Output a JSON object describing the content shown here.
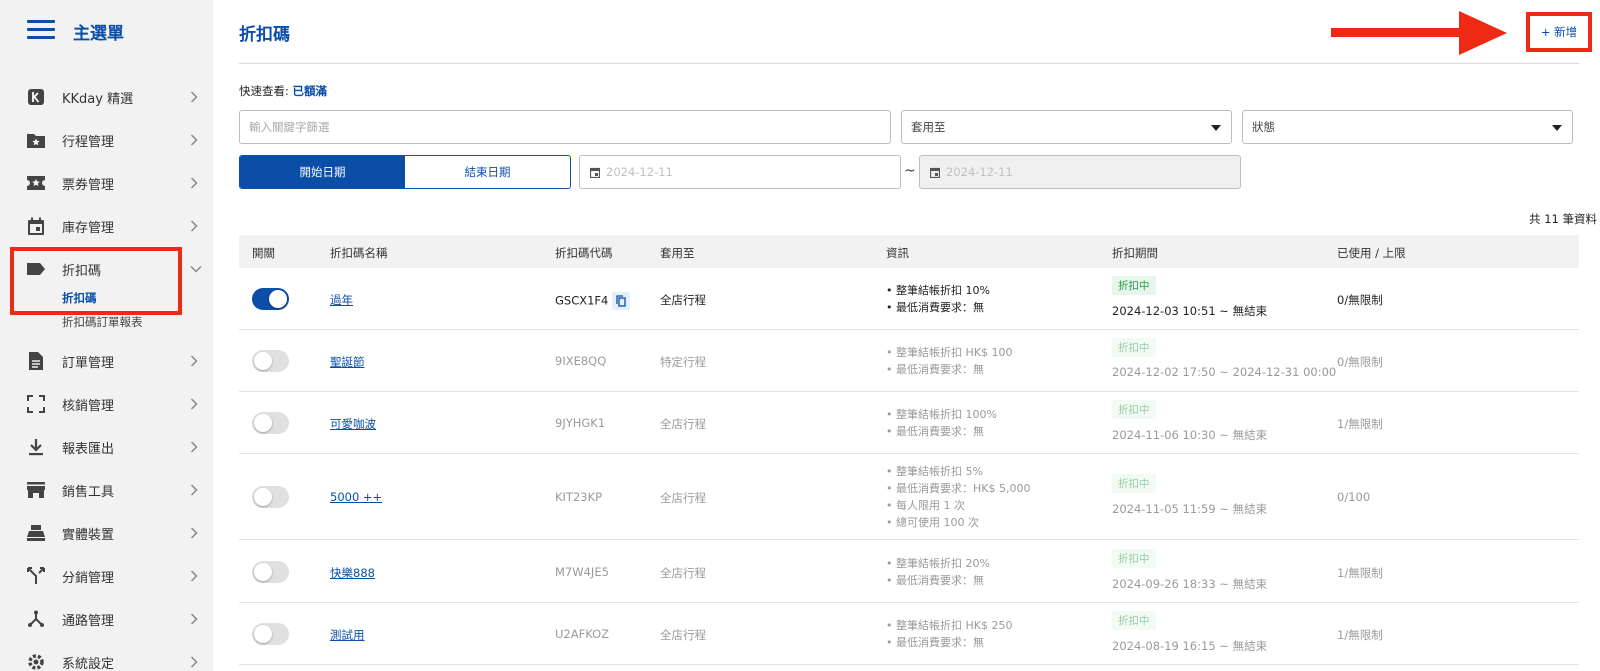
{
  "sidebar": {
    "title": "主選單",
    "items": [
      {
        "label": "KKday 精選",
        "icon": "kkday-logo-icon"
      },
      {
        "label": "行程管理",
        "icon": "folder-star-icon"
      },
      {
        "label": "票券管理",
        "icon": "ticket-star-icon"
      },
      {
        "label": "庫存管理",
        "icon": "calendar-icon"
      },
      {
        "label": "折扣碼",
        "icon": "tag-icon"
      },
      {
        "label": "訂單管理",
        "icon": "document-icon"
      },
      {
        "label": "核銷管理",
        "icon": "scan-frame-icon"
      },
      {
        "label": "報表匯出",
        "icon": "download-icon"
      },
      {
        "label": "銷售工具",
        "icon": "store-icon"
      },
      {
        "label": "實體裝置",
        "icon": "cash-register-icon"
      },
      {
        "label": "分銷管理",
        "icon": "merge-arrows-icon"
      },
      {
        "label": "通路管理",
        "icon": "hub-icon"
      },
      {
        "label": "系統設定",
        "icon": "gear-icon"
      }
    ],
    "sub_items": [
      {
        "label": "折扣碼"
      },
      {
        "label": "折扣碼訂單報表"
      }
    ]
  },
  "header": {
    "title": "折扣碼",
    "add_label": "+ 新增"
  },
  "quick_view": {
    "label": "快速查看:",
    "link": "已額滿"
  },
  "filters": {
    "keyword_placeholder": "輸入關鍵字篩選",
    "apply_to_label": "套用至",
    "status_label": "狀態",
    "start_date_tab": "開始日期",
    "end_date_tab": "結束日期",
    "date_from": "2024-12-11",
    "tilde": "~",
    "date_to": "2024-12-11"
  },
  "total_text": "共 11 筆資料",
  "table": {
    "headers": [
      "開關",
      "折扣碼名稱",
      "折扣碼代碼",
      "套用至",
      "資訊",
      "折扣期間",
      "已使用 / 上限"
    ],
    "rows": [
      {
        "enabled": true,
        "name": "過年",
        "code": "GSCX1F4",
        "apply": "全店行程",
        "info": [
          "• 整筆結帳折扣 10%",
          "• 最低消費要求：無"
        ],
        "badge": "折扣中",
        "period": "2024-12-03 10:51 ~ 無結束",
        "usage": "0/無限制"
      },
      {
        "enabled": false,
        "name": "聖誕節",
        "code": "9IXE8QQ",
        "apply": "特定行程",
        "info": [
          "• 整筆結帳折扣 HK$ 100",
          "• 最低消費要求：無"
        ],
        "badge": "折扣中",
        "period": "2024-12-02 17:50 ~ 2024-12-31 00:00",
        "usage": "0/無限制"
      },
      {
        "enabled": false,
        "name": "可愛咖波",
        "code": "9JYHGK1",
        "apply": "全店行程",
        "info": [
          "• 整筆結帳折扣 100%",
          "• 最低消費要求：無"
        ],
        "badge": "折扣中",
        "period": "2024-11-06 10:30 ~ 無結束",
        "usage": "1/無限制"
      },
      {
        "enabled": false,
        "name": "5000 ++",
        "code": "KIT23KP",
        "apply": "全店行程",
        "info": [
          "• 整筆結帳折扣 5%",
          "• 最低消費要求：HK$ 5,000",
          "• 每人限用 1 次",
          "• 總可使用 100 次"
        ],
        "badge": "折扣中",
        "period": "2024-11-05 11:59 ~ 無結束",
        "usage": "0/100"
      },
      {
        "enabled": false,
        "name": "快樂888",
        "code": "M7W4JE5",
        "apply": "全店行程",
        "info": [
          "• 整筆結帳折扣 20%",
          "• 最低消費要求：無"
        ],
        "badge": "折扣中",
        "period": "2024-09-26 18:33 ~ 無結束",
        "usage": "1/無限制"
      },
      {
        "enabled": false,
        "name": "測試用",
        "code": "U2AFKOZ",
        "apply": "全店行程",
        "info": [
          "• 整筆結帳折扣 HK$ 250",
          "• 最低消費要求：無"
        ],
        "badge": "折扣中",
        "period": "2024-08-19 16:15 ~ 無結束",
        "usage": "1/無限制"
      }
    ]
  },
  "colors": {
    "accent": "#0a4ea8",
    "highlight": "#ee2a15",
    "badge_bg": "#e6f6ea",
    "badge_text": "#2e9b4a"
  }
}
